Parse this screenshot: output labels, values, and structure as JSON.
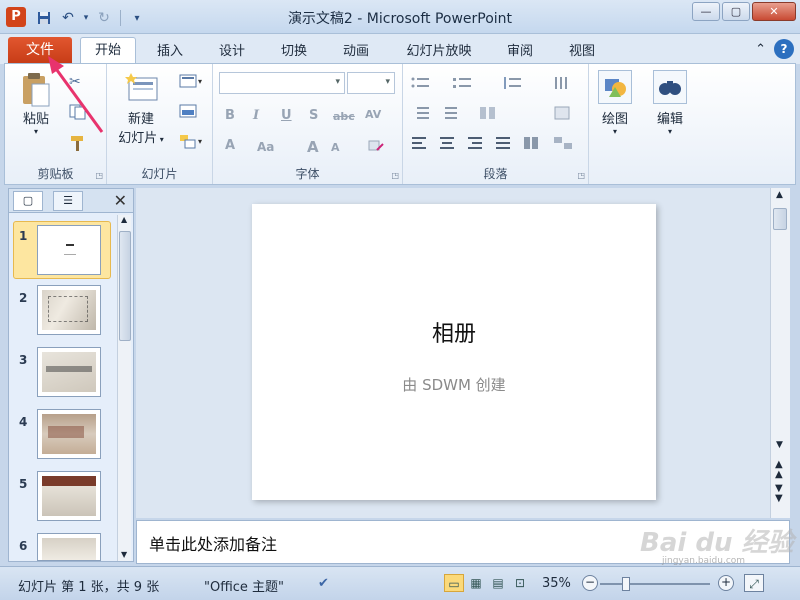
{
  "window": {
    "title": "演示文稿2 - Microsoft PowerPoint",
    "app_icon_letter": "P",
    "controls": {
      "minimize": "—",
      "maximize": "▢",
      "close": "✕"
    }
  },
  "qat": {
    "save_icon": "floppy-icon",
    "undo": "↶",
    "redo": "↻",
    "customize": "▾"
  },
  "tabs": {
    "file": "文件",
    "items": [
      "开始",
      "插入",
      "设计",
      "切换",
      "动画",
      "幻灯片放映",
      "审阅",
      "视图"
    ],
    "active": "开始",
    "collapse": "⌃",
    "help": "?"
  },
  "ribbon": {
    "clipboard": {
      "label": "剪贴板",
      "paste": "粘贴"
    },
    "slides": {
      "label": "幻灯片",
      "new_slide_line1": "新建",
      "new_slide_line2": "幻灯片"
    },
    "font": {
      "label": "字体",
      "bold": "B",
      "italic": "I",
      "underline": "U",
      "shadow": "S",
      "strike": "abc",
      "spacing": "AV",
      "case": "Aa",
      "grow": "A",
      "shrink": "A",
      "color": "A"
    },
    "paragraph": {
      "label": "段落"
    },
    "drawing": {
      "label": "绘图"
    },
    "editing": {
      "label": "编辑"
    }
  },
  "slides_panel": {
    "tab_slides": "▢",
    "tab_outline": "☰",
    "close": "✕",
    "thumbs": [
      {
        "num": "1",
        "selected": true
      },
      {
        "num": "2",
        "selected": false
      },
      {
        "num": "3",
        "selected": false
      },
      {
        "num": "4",
        "selected": false
      },
      {
        "num": "5",
        "selected": false
      },
      {
        "num": "6",
        "selected": false
      }
    ]
  },
  "slide": {
    "title": "相册",
    "subtitle": "由 SDWM 创建"
  },
  "notes": {
    "placeholder": "单击此处添加备注"
  },
  "status": {
    "slide_info": "幻灯片 第 1 张，共 9 张",
    "theme": "\"Office 主题\"",
    "zoom": "35%",
    "zoom_fraction": 0.35
  },
  "watermark": {
    "text": "Bai du 经验",
    "url": "jingyan.baidu.com"
  },
  "colors": {
    "file_tab": "#d2441a",
    "accent_arrow": "#e8336d",
    "selection": "#fde6a0"
  }
}
